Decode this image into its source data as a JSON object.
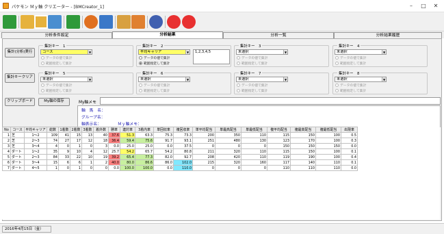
{
  "window": {
    "title": "パケモン Ｍｙ軸 クリエーター - [BMCreator_1]"
  },
  "colors": {
    "hl_yellow": "#ffff66",
    "hl_red": "#ff8080",
    "hl_green": "#c8f0a0",
    "hl_cyan": "#80e8ff",
    "hl_blue": "#9ad0ff"
  },
  "toolbar": {
    "icons": [
      "exit-icon",
      "open-folder-icon",
      "open-file-icon",
      "copy-icon",
      "download-icon",
      "run-icon",
      "link-icon",
      "export-icon",
      "share-icon",
      "settings-icon",
      "info-icon",
      "help-icon"
    ]
  },
  "tabs": [
    "分析条件設定",
    "分析結果",
    "分析一覧",
    "分析結果履歴"
  ],
  "buttons": {
    "run": "集計(分析)実行",
    "clear": "集計キークリア",
    "clipboard": "クリップボード",
    "save_axis": "My軸の保存"
  },
  "keys": [
    {
      "label": "集計キー　1",
      "value": "コース",
      "highlight": true,
      "r1": "データの値で集計",
      "r2": "範囲指定して集計",
      "enabled": false,
      "mode": ""
    },
    {
      "label": "集計キー　2",
      "value": "平均キャリア",
      "highlight": true,
      "r1": "データの値で集計",
      "r2": "範囲指定して集計",
      "enabled": true,
      "mode": "range",
      "range_text": "1,2,3,4,5"
    },
    {
      "label": "集計キー　3",
      "value": "未選択",
      "highlight": false,
      "r1": "データの値で集計",
      "r2": "範囲指定して集計",
      "enabled": false,
      "mode": ""
    },
    {
      "label": "集計キー　4",
      "value": "未選択",
      "highlight": false,
      "r1": "データの値で集計",
      "r2": "範囲指定して集計",
      "enabled": false,
      "mode": ""
    },
    {
      "label": "集計キー　5",
      "value": "未選択",
      "highlight": false,
      "r1": "データの値で集計",
      "r2": "範囲指定して集計",
      "enabled": false,
      "mode": ""
    },
    {
      "label": "集計キー　6",
      "value": "未選択",
      "highlight": false,
      "r1": "データの値で集計",
      "r2": "範囲指定して集計",
      "enabled": false,
      "mode": ""
    },
    {
      "label": "集計キー　7",
      "value": "未選択",
      "highlight": false,
      "r1": "データの値で集計",
      "r2": "範囲指定して集計",
      "enabled": false,
      "mode": ""
    },
    {
      "label": "集計キー　8",
      "value": "未選択",
      "highlight": false,
      "r1": "データの値で集計",
      "r2": "範囲指定して集計",
      "enabled": false,
      "mode": ""
    }
  ],
  "memo": {
    "label": "My軸メモ",
    "value": ""
  },
  "info": {
    "axis_name": "軸　馬　名：",
    "group_name": "グループ名：",
    "axis_display": "軸表示名：",
    "my_memo": "Ｍｙ軸メモ："
  },
  "table": {
    "headers": [
      "No",
      "コース",
      "平均キャリア",
      "総数",
      "1着数",
      "2着数",
      "3着数",
      "着外数",
      "勝率",
      "連対率",
      "3着内率",
      "単回収率",
      "複回収率",
      "単平均配当",
      "単最高配当",
      "単最低配当",
      "複平均配当",
      "複最高配当",
      "複最低配当",
      "出現率"
    ],
    "rows": [
      [
        "1",
        "芝",
        "1～2",
        "109",
        "41",
        "15",
        "13",
        "40",
        "37.6",
        "51.3",
        "63.3",
        "75.3",
        "73.3",
        "200",
        "350",
        "110",
        "115",
        "150",
        "100",
        "0.5"
      ],
      [
        "2",
        "芝",
        "2～3",
        "74",
        "27",
        "17",
        "12",
        "18",
        "36.4",
        "59.4",
        "75.6",
        "91.7",
        "93.1",
        "251",
        "480",
        "130",
        "123",
        "170",
        "100",
        "0.3"
      ],
      [
        "3",
        "芝",
        "3～4",
        "4",
        "0",
        "1",
        "0",
        "3",
        "0.0",
        "25.0",
        "25.0",
        "0.0",
        "37.5",
        "0",
        "0",
        "0",
        "150",
        "150",
        "150",
        "0.0"
      ],
      [
        "4",
        "ダート",
        "1～2",
        "35",
        "9",
        "10",
        "4",
        "12",
        "25.7",
        "54.2",
        "65.7",
        "54.2",
        "80.8",
        "211",
        "320",
        "110",
        "115",
        "150",
        "100",
        "0.1"
      ],
      [
        "5",
        "ダート",
        "2～3",
        "84",
        "33",
        "22",
        "10",
        "19",
        "39.2",
        "65.4",
        "77.3",
        "82.0",
        "92.7",
        "208",
        "420",
        "110",
        "119",
        "190",
        "100",
        "0.4"
      ],
      [
        "6",
        "ダート",
        "3～4",
        "15",
        "6",
        "6",
        "1",
        "2",
        "40.0",
        "80.0",
        "86.6",
        "86.0",
        "102.0",
        "215",
        "320",
        "160",
        "117",
        "140",
        "110",
        "0.1"
      ],
      [
        "7",
        "ダート",
        "4～5",
        "1",
        "0",
        "1",
        "0",
        "0",
        "0.0",
        "100.0",
        "100.0",
        "0.0",
        "110.0",
        "0",
        "0",
        "0",
        "110",
        "110",
        "110",
        "0.0"
      ]
    ],
    "cell_colors": {
      "1-8": "hl_red",
      "2-8": "hl_red",
      "5-8": "hl_red",
      "6-8": "hl_red",
      "1-9": "hl_yellow",
      "2-9": "hl_green",
      "4-9": "hl_yellow",
      "5-9": "hl_green",
      "6-9": "hl_green",
      "7-9": "hl_green",
      "2-10": "hl_green",
      "5-10": "hl_green",
      "6-10": "hl_green",
      "7-10": "hl_green",
      "6-12": "hl_cyan",
      "7-12": "hl_cyan"
    }
  },
  "status": {
    "date": "2016年4月15日（金）"
  }
}
